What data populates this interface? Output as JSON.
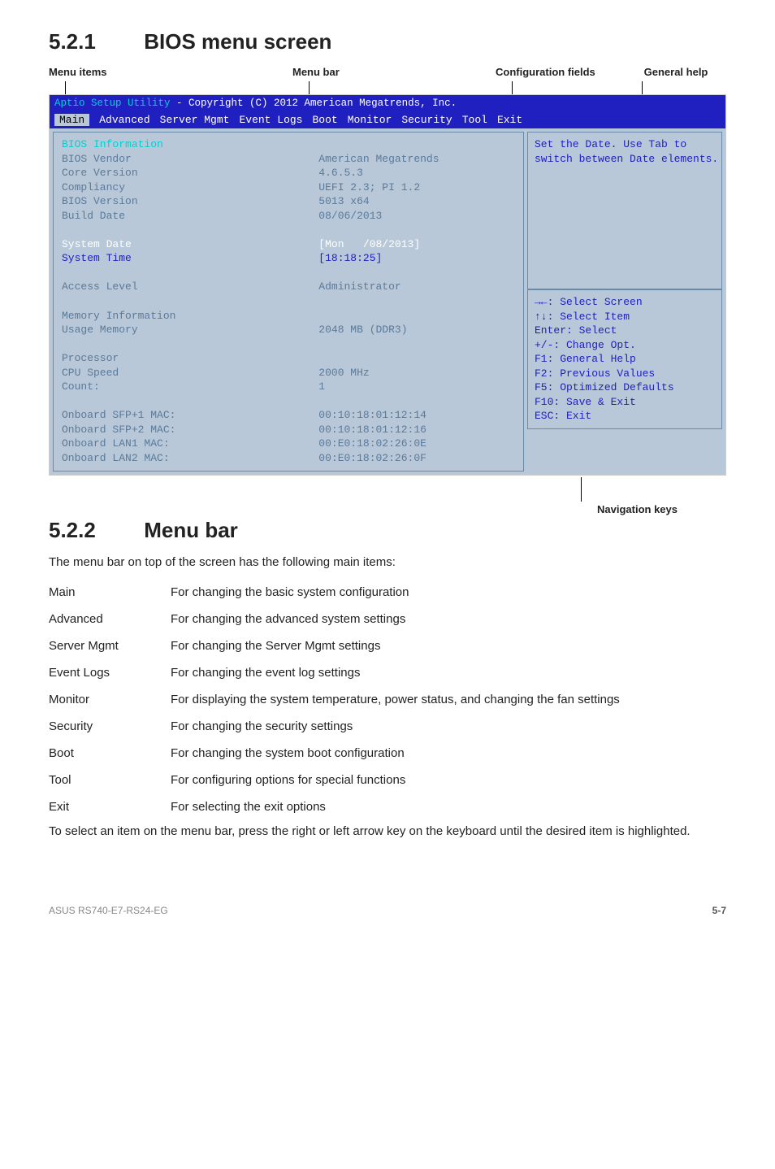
{
  "section1": {
    "num": "5.2.1",
    "title": "BIOS menu screen"
  },
  "callouts": {
    "menu_items": "Menu items",
    "menu_bar": "Menu bar",
    "config_fields": "Configuration fields",
    "general_help": "General help",
    "nav_keys": "Navigation keys"
  },
  "bios": {
    "title_prefix": "Aptio Setup Utility",
    "title_rest": " - Copyright (C) 2012 American Megatrends, Inc.",
    "menubar": [
      "Main",
      "Advanced",
      "Server Mgmt",
      "Event Logs",
      "Boot",
      "Monitor",
      "Security",
      "Tool",
      "Exit"
    ],
    "active_tab_index": 0,
    "left_labels": [
      "BIOS Information",
      "BIOS Vendor",
      "Core Version",
      "Compliancy",
      "BIOS Version",
      "Build Date",
      "",
      "System Date",
      "System Time",
      "",
      "Access Level",
      "",
      "Memory Information",
      "Usage Memory",
      "",
      "Processor",
      "CPU Speed",
      "Count:",
      "",
      "Onboard SFP+1 MAC:",
      "Onboard SFP+2 MAC:",
      "Onboard LAN1 MAC:",
      "Onboard LAN2 MAC:"
    ],
    "left_values": [
      "",
      "American Megatrends",
      "4.6.5.3",
      "UEFI 2.3; PI 1.2",
      "5013 x64",
      "08/06/2013",
      "",
      "[Mon   /08/2013]",
      "[18:18:25]",
      "",
      "Administrator",
      "",
      "",
      "2048 MB (DDR3)",
      "",
      "",
      "2000 MHz",
      "1",
      "",
      "00:10:18:01:12:14",
      "00:10:18:01:12:16",
      "00:E0:18:02:26:0E",
      "00:E0:18:02:26:0F"
    ],
    "left_value_classes": [
      "",
      "",
      "",
      "",
      "",
      "",
      "",
      "sel",
      "blue",
      "",
      "",
      "",
      "",
      "",
      "",
      "",
      "",
      "",
      "",
      "",
      "",
      "",
      ""
    ],
    "left_label_classes": [
      "cyan",
      "",
      "",
      "",
      "",
      "",
      "",
      "sel",
      "blue",
      "",
      "",
      "",
      "",
      "",
      "",
      "",
      "",
      "",
      "",
      "",
      "",
      "",
      ""
    ],
    "help_top": [
      "Set the Date. Use Tab to",
      "switch between Date elements."
    ],
    "help_bottom": [
      "→←: Select Screen",
      "↑↓: Select Item",
      "Enter: Select",
      "+/-: Change Opt.",
      "F1: General Help",
      "F2: Previous Values",
      "F5: Optimized Defaults",
      "F10: Save & Exit",
      "ESC: Exit"
    ]
  },
  "section2": {
    "num": "5.2.2",
    "title": "Menu bar"
  },
  "menubar_intro": "The menu bar on top of the screen has the following main items:",
  "defs": [
    {
      "term": "Main",
      "desc": "For changing the basic system configuration"
    },
    {
      "term": "Advanced",
      "desc": "For changing the advanced system settings"
    },
    {
      "term": "Server Mgmt",
      "desc": "For changing the Server Mgmt settings"
    },
    {
      "term": "Event Logs",
      "desc": "For changing the event log settings"
    },
    {
      "term": "Monitor",
      "desc": "For displaying the system temperature, power status, and changing the fan settings"
    },
    {
      "term": "Security",
      "desc": "For changing the security settings"
    },
    {
      "term": "Boot",
      "desc": "For changing the system boot configuration"
    },
    {
      "term": "Tool",
      "desc": "For configuring options for special functions"
    },
    {
      "term": "Exit",
      "desc": "For selecting the exit options"
    }
  ],
  "outro": "To select an item on the menu bar, press the right or left arrow key on the keyboard until the desired item is highlighted.",
  "footer": {
    "left": "ASUS RS740-E7-RS24-EG",
    "right": "5-7"
  }
}
